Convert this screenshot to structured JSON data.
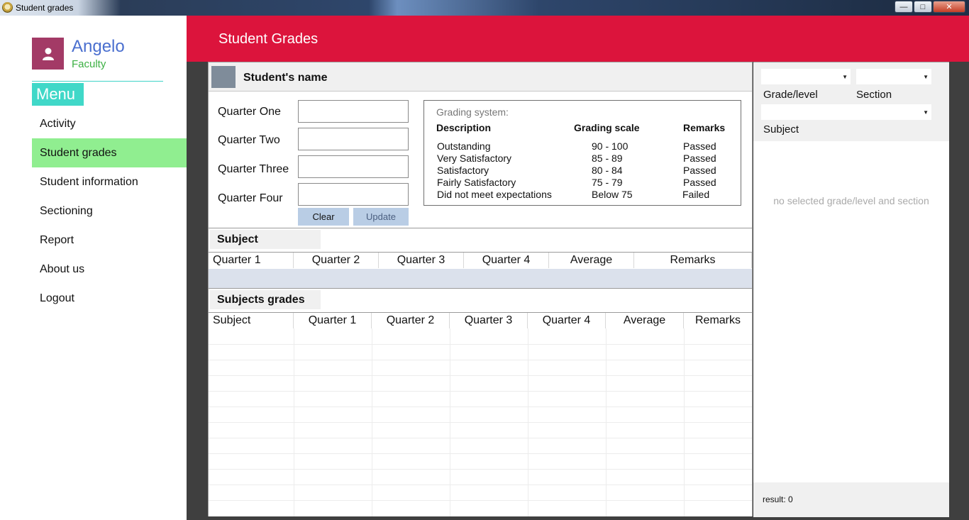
{
  "window": {
    "title": "Student grades"
  },
  "user": {
    "name": "Angelo",
    "role": "Faculty"
  },
  "menu": {
    "header": "Menu",
    "items": [
      {
        "label": "Activity"
      },
      {
        "label": "Student grades",
        "active": true
      },
      {
        "label": "Student information"
      },
      {
        "label": "Sectioning"
      },
      {
        "label": "Report"
      },
      {
        "label": "About us"
      },
      {
        "label": "Logout"
      }
    ]
  },
  "header": {
    "title": "Student Grades"
  },
  "student": {
    "name_label": "Student's name"
  },
  "quarters": {
    "q1": "Quarter One",
    "q2": "Quarter Two",
    "q3": "Quarter Three",
    "q4": "Quarter Four",
    "values": [
      "",
      "",
      "",
      ""
    ]
  },
  "buttons": {
    "clear": "Clear",
    "update": "Update"
  },
  "grading": {
    "caption": "Grading system:",
    "headers": [
      "Description",
      "Grading scale",
      "Remarks"
    ],
    "rows": [
      {
        "description": "Outstanding",
        "scale": "90 - 100",
        "remarks": "Passed"
      },
      {
        "description": "Very Satisfactory",
        "scale": "85 - 89",
        "remarks": "Passed"
      },
      {
        "description": "Satisfactory",
        "scale": "80 - 84",
        "remarks": "Passed"
      },
      {
        "description": "Fairly Satisfactory",
        "scale": "75 - 79",
        "remarks": "Passed"
      },
      {
        "description": "Did not meet expectations",
        "scale": "Below 75",
        "remarks": "Failed"
      }
    ]
  },
  "subject_table": {
    "tab": "Subject",
    "columns": [
      "Quarter 1",
      "Quarter 2",
      "Quarter 3",
      "Quarter 4",
      "Average",
      "Remarks"
    ]
  },
  "subjects_grades": {
    "tab": "Subjects grades",
    "columns": [
      "Subject",
      "Quarter 1",
      "Quarter 2",
      "Quarter 3",
      "Quarter 4",
      "Average",
      "Remarks"
    ]
  },
  "filters": {
    "grade_label": "Grade/level",
    "section_label": "Section",
    "subject_label": "Subject",
    "grade_value": "",
    "section_value": "",
    "subject_value": ""
  },
  "right": {
    "empty_message": "no selected grade/level and section",
    "result_text": "result:  0"
  },
  "colors": {
    "header": "#dc143c",
    "menu_accent": "#40d8c8",
    "active_item": "#90ee90",
    "avatar": "#a33a66"
  },
  "icons": {
    "avatar": "user-icon",
    "app": "app-icon"
  }
}
